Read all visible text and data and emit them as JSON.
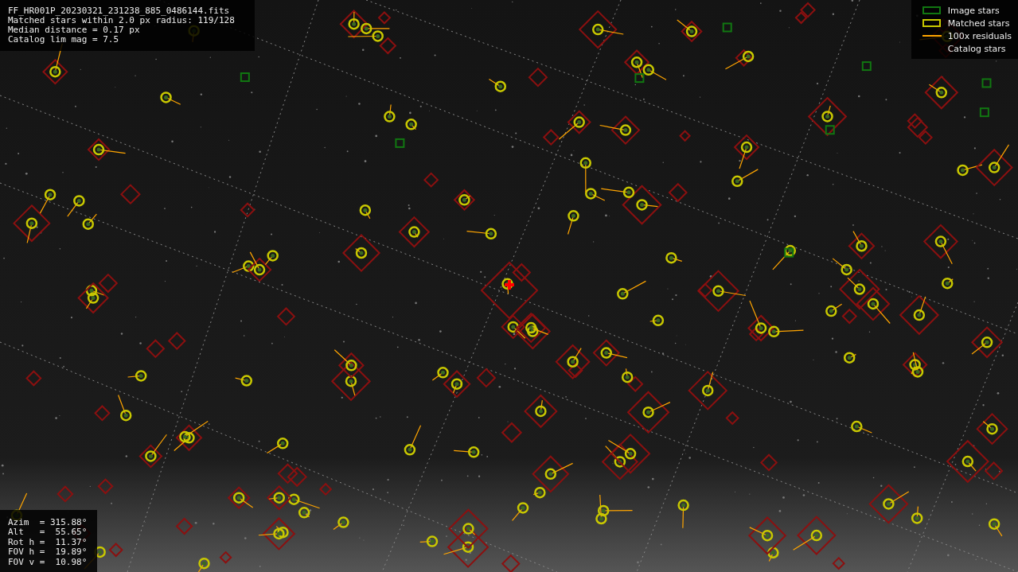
{
  "info_panel": {
    "lines": [
      "FF_HR001P_20230321_231238_885_0486144.fits",
      "Matched stars within 2.0 px radius: 119/128",
      "Median distance = 0.17 px",
      "Catalog lim mag = 7.5"
    ]
  },
  "legend": [
    {
      "label": "Image stars",
      "kind": "box",
      "color": "#117711"
    },
    {
      "label": "Matched stars",
      "kind": "box",
      "color": "#c8c800"
    },
    {
      "label": "100x residuals",
      "kind": "line",
      "color": "#ffa500"
    },
    {
      "label": "Catalog stars",
      "kind": "none"
    }
  ],
  "pointing_panel": {
    "lines": [
      "Azim  = 315.88°",
      "Alt   =  55.65°",
      "Rot h =  11.37°",
      "FOV h =  19.89°",
      "FOV v =  10.98°"
    ]
  }
}
